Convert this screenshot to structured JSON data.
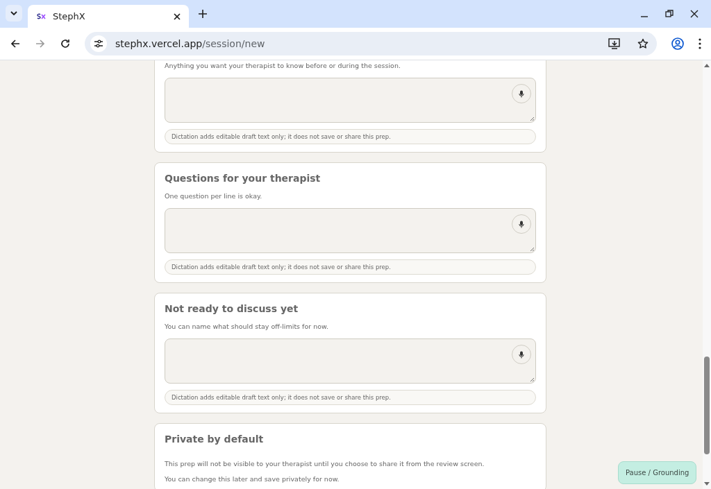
{
  "browser": {
    "tab_title": "StephX",
    "url_host": "stephx.vercel.app",
    "url_path": "/session/new"
  },
  "sections": [
    {
      "kind": "prompt",
      "hint": "Anything you want your therapist to know before or during the session.",
      "note": "Dictation adds editable draft text only; it does not save or share this prep."
    },
    {
      "kind": "prompt",
      "title": "Questions for your therapist",
      "hint": "One question per line is okay.",
      "note": "Dictation adds editable draft text only; it does not save or share this prep."
    },
    {
      "kind": "prompt",
      "title": "Not ready to discuss yet",
      "hint": "You can name what should stay off-limits for now.",
      "note": "Dictation adds editable draft text only; it does not save or share this prep."
    },
    {
      "kind": "info",
      "title": "Private by default",
      "paragraphs": [
        "This prep will not be visible to your therapist until you choose to share it from the review screen.",
        "You can change this later and save privately for now."
      ]
    }
  ],
  "floating_button": "Pause / Grounding"
}
